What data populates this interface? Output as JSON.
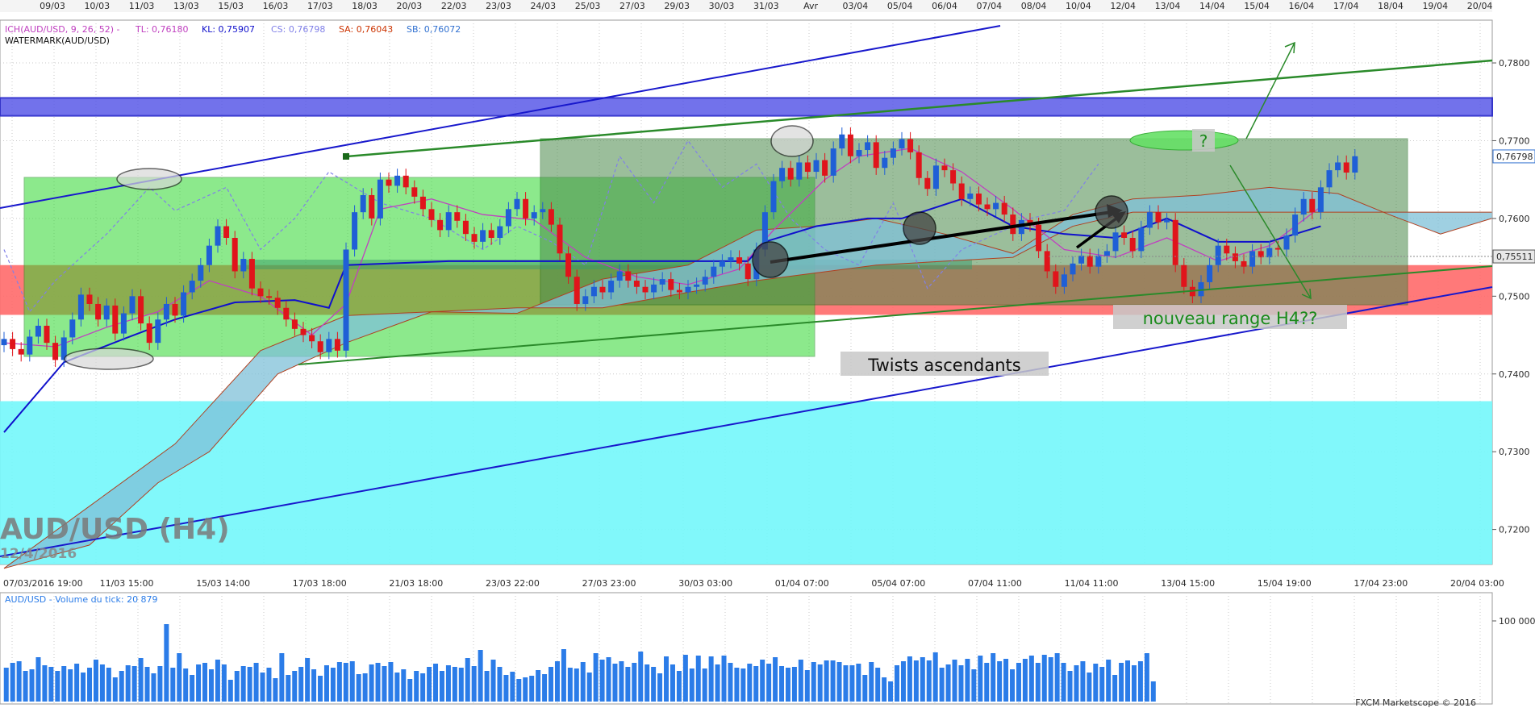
{
  "indicator_header": {
    "ich": "ICH(AUD/USD, 9, 26, 52)  -",
    "tl": "TL: 0,76180",
    "kl": "KL: 0,75907",
    "cs": "CS: 0,76798",
    "sa": "SA: 0,76043",
    "sb": "SB: 0,76072",
    "watermark": "WATERMARK(AUD/USD)"
  },
  "watermark": {
    "title": "AUD/USD (H4)",
    "date": "12/4/2016"
  },
  "volume_header": "AUD/USD - Volume du tick: 20 879",
  "footer": "FXCM Marketscope © 2016",
  "annotations": {
    "question": "?",
    "range": "nouveau range H4??",
    "twists": "Twists ascendants"
  },
  "colors": {
    "bull": "#1f5fd6",
    "bear": "#e0141b",
    "volume": "#2b7ce8",
    "kijun": "#1010cc",
    "tenkan": "#c040c0",
    "chikou": "#8080e8",
    "cloud_bull": "#7fc0d8",
    "cloud_bear": "#c8a090",
    "resistance_zone": "#5a5ae8",
    "support_zone": "#ff6a6a",
    "lower_zone": "#73f7fb",
    "green_box": "#30d830",
    "dark_box": "#4a8a4a"
  },
  "chart_data": [
    {
      "type": "candlestick",
      "symbol": "AUD/USD",
      "timeframe": "H4",
      "top_axis_dates": [
        "09/03",
        "10/03",
        "11/03",
        "13/03",
        "15/03",
        "16/03",
        "17/03",
        "18/03",
        "20/03",
        "22/03",
        "23/03",
        "24/03",
        "25/03",
        "27/03",
        "29/03",
        "30/03",
        "31/03",
        "Avr",
        "03/04",
        "05/04",
        "06/04",
        "07/04",
        "08/04",
        "10/04",
        "12/04",
        "13/04",
        "14/04",
        "15/04",
        "16/04",
        "17/04",
        "18/04",
        "19/04",
        "20/04"
      ],
      "bottom_axis_labels": [
        "07/03/2016 19:00",
        "11/03 15:00",
        "15/03 14:00",
        "17/03 18:00",
        "21/03 18:00",
        "23/03 22:00",
        "27/03 23:00",
        "30/03 03:00",
        "01/04 07:00",
        "05/04 07:00",
        "07/04 11:00",
        "11/04 11:00",
        "13/04 15:00",
        "15/04 19:00",
        "17/04 23:00",
        "20/04 03:00"
      ],
      "y_ticks": [
        "0,7800",
        "0,7700",
        "0,7600",
        "0,7500",
        "0,7400",
        "0,7300",
        "0,7200"
      ],
      "ylim": [
        0.7155,
        0.7855
      ],
      "current_price_label": "0,76798",
      "reference_price_label": "0,75511",
      "close_series": [
        0.7445,
        0.7432,
        0.7425,
        0.7448,
        0.7462,
        0.744,
        0.7418,
        0.7447,
        0.747,
        0.7502,
        0.749,
        0.747,
        0.7488,
        0.7452,
        0.7478,
        0.75,
        0.7465,
        0.744,
        0.747,
        0.749,
        0.7475,
        0.7505,
        0.752,
        0.754,
        0.7565,
        0.759,
        0.7575,
        0.7532,
        0.7548,
        0.751,
        0.75,
        0.7498,
        0.7485,
        0.747,
        0.7458,
        0.745,
        0.7442,
        0.7428,
        0.7445,
        0.743,
        0.756,
        0.7608,
        0.763,
        0.76,
        0.765,
        0.7642,
        0.7655,
        0.764,
        0.7628,
        0.7612,
        0.7598,
        0.7585,
        0.7608,
        0.7597,
        0.758,
        0.757,
        0.7585,
        0.7575,
        0.759,
        0.7612,
        0.7625,
        0.76,
        0.7608,
        0.7612,
        0.7592,
        0.7555,
        0.7525,
        0.749,
        0.75,
        0.7512,
        0.7505,
        0.752,
        0.7532,
        0.752,
        0.7512,
        0.7505,
        0.7515,
        0.7522,
        0.7508,
        0.7505,
        0.7512,
        0.7515,
        0.7525,
        0.7538,
        0.7545,
        0.755,
        0.7542,
        0.7522,
        0.756,
        0.7608,
        0.7648,
        0.7665,
        0.765,
        0.7672,
        0.766,
        0.7675,
        0.7655,
        0.769,
        0.7708,
        0.768,
        0.7688,
        0.7698,
        0.7665,
        0.7678,
        0.769,
        0.7702,
        0.7685,
        0.7652,
        0.7638,
        0.7668,
        0.7662,
        0.7645,
        0.7625,
        0.7632,
        0.7618,
        0.7612,
        0.762,
        0.7605,
        0.758,
        0.7598,
        0.7592,
        0.7558,
        0.7532,
        0.7512,
        0.7528,
        0.7542,
        0.7552,
        0.7538,
        0.7552,
        0.7558,
        0.7582,
        0.7575,
        0.7558,
        0.7588,
        0.7608,
        0.7595,
        0.7598,
        0.754,
        0.7512,
        0.75,
        0.7518,
        0.754,
        0.7565,
        0.7555,
        0.7545,
        0.7538,
        0.7558,
        0.755,
        0.7562,
        0.756,
        0.7578,
        0.7605,
        0.7625,
        0.7608,
        0.764,
        0.7662,
        0.7672,
        0.7659,
        0.768
      ],
      "kijun": [
        [
          0,
          0.7325
        ],
        [
          7,
          0.7415
        ],
        [
          14,
          0.7445
        ],
        [
          20,
          0.747
        ],
        [
          27,
          0.7492
        ],
        [
          34,
          0.7495
        ],
        [
          38,
          0.7485
        ],
        [
          40,
          0.754
        ],
        [
          52,
          0.7545
        ],
        [
          64,
          0.7545
        ],
        [
          80,
          0.7545
        ],
        [
          87,
          0.7545
        ],
        [
          89,
          0.757
        ],
        [
          95,
          0.759
        ],
        [
          101,
          0.76
        ],
        [
          105,
          0.76
        ],
        [
          112,
          0.7625
        ],
        [
          118,
          0.759
        ],
        [
          124,
          0.758
        ],
        [
          130,
          0.7575
        ],
        [
          136,
          0.76
        ],
        [
          142,
          0.757
        ],
        [
          148,
          0.757
        ],
        [
          154,
          0.759
        ]
      ],
      "tenkan": [
        [
          0,
          0.744
        ],
        [
          6,
          0.7435
        ],
        [
          12,
          0.746
        ],
        [
          18,
          0.748
        ],
        [
          24,
          0.752
        ],
        [
          30,
          0.75
        ],
        [
          36,
          0.745
        ],
        [
          40,
          0.749
        ],
        [
          44,
          0.7612
        ],
        [
          50,
          0.7625
        ],
        [
          56,
          0.7605
        ],
        [
          62,
          0.7598
        ],
        [
          68,
          0.755
        ],
        [
          74,
          0.7525
        ],
        [
          80,
          0.7515
        ],
        [
          86,
          0.7535
        ],
        [
          90,
          0.7585
        ],
        [
          96,
          0.765
        ],
        [
          100,
          0.768
        ],
        [
          106,
          0.769
        ],
        [
          112,
          0.766
        ],
        [
          118,
          0.7612
        ],
        [
          124,
          0.756
        ],
        [
          130,
          0.755
        ],
        [
          136,
          0.7575
        ],
        [
          142,
          0.7545
        ],
        [
          148,
          0.7565
        ],
        [
          154,
          0.7615
        ]
      ],
      "chikou": [
        [
          0,
          0.756
        ],
        [
          3,
          0.748
        ],
        [
          6,
          0.752
        ],
        [
          12,
          0.758
        ],
        [
          17,
          0.764
        ],
        [
          20,
          0.761
        ],
        [
          26,
          0.764
        ],
        [
          30,
          0.756
        ],
        [
          34,
          0.76
        ],
        [
          38,
          0.766
        ],
        [
          44,
          0.762
        ],
        [
          50,
          0.76
        ],
        [
          56,
          0.756
        ],
        [
          60,
          0.759
        ],
        [
          64,
          0.757
        ],
        [
          68,
          0.754
        ],
        [
          72,
          0.768
        ],
        [
          76,
          0.762
        ],
        [
          80,
          0.77
        ],
        [
          84,
          0.764
        ],
        [
          88,
          0.767
        ],
        [
          92,
          0.76
        ],
        [
          96,
          0.756
        ],
        [
          100,
          0.754
        ],
        [
          104,
          0.762
        ],
        [
          108,
          0.751
        ],
        [
          112,
          0.756
        ],
        [
          116,
          0.758
        ],
        [
          120,
          0.76
        ],
        [
          124,
          0.761
        ],
        [
          128,
          0.767
        ]
      ],
      "senkou_a": [
        [
          0,
          0.715
        ],
        [
          10,
          0.723
        ],
        [
          20,
          0.731
        ],
        [
          30,
          0.743
        ],
        [
          40,
          0.7475
        ],
        [
          50,
          0.748
        ],
        [
          60,
          0.7478
        ],
        [
          70,
          0.7522
        ],
        [
          80,
          0.754
        ],
        [
          88,
          0.7585
        ],
        [
          95,
          0.759
        ],
        [
          102,
          0.76
        ],
        [
          110,
          0.758
        ],
        [
          118,
          0.7555
        ],
        [
          125,
          0.7605
        ],
        [
          132,
          0.7625
        ],
        [
          140,
          0.763
        ],
        [
          148,
          0.764
        ],
        [
          156,
          0.7632
        ],
        [
          162,
          0.7605
        ],
        [
          168,
          0.758
        ],
        [
          174,
          0.76
        ]
      ],
      "senkou_b": [
        [
          0,
          0.715
        ],
        [
          10,
          0.718
        ],
        [
          18,
          0.726
        ],
        [
          24,
          0.73
        ],
        [
          32,
          0.74
        ],
        [
          40,
          0.744
        ],
        [
          50,
          0.748
        ],
        [
          60,
          0.7485
        ],
        [
          70,
          0.7485
        ],
        [
          80,
          0.7505
        ],
        [
          88,
          0.752
        ],
        [
          95,
          0.753
        ],
        [
          102,
          0.754
        ],
        [
          110,
          0.7545
        ],
        [
          118,
          0.755
        ],
        [
          125,
          0.759
        ],
        [
          132,
          0.7608
        ],
        [
          140,
          0.7608
        ],
        [
          148,
          0.7608
        ],
        [
          156,
          0.7608
        ],
        [
          162,
          0.7608
        ],
        [
          168,
          0.7608
        ],
        [
          174,
          0.7608
        ]
      ],
      "volume": [
        42,
        48,
        50,
        38,
        40,
        55,
        45,
        43,
        38,
        44,
        40,
        47,
        36,
        42,
        52,
        46,
        42,
        30,
        38,
        45,
        44,
        54,
        43,
        35,
        44,
        96,
        42,
        60,
        41,
        33,
        46,
        48,
        40,
        52,
        46,
        27,
        38,
        44,
        43,
        48,
        36,
        42,
        29,
        60,
        33,
        38,
        43,
        54,
        40,
        32,
        45,
        42,
        49,
        48,
        50,
        34,
        35,
        46,
        48,
        44,
        49,
        36,
        40,
        28,
        38,
        35,
        43,
        47,
        38,
        45,
        43,
        42,
        54,
        44,
        64,
        38,
        52,
        43,
        33,
        37,
        28,
        30,
        32,
        39,
        34,
        43,
        50,
        65,
        42,
        41,
        49,
        36,
        60,
        52,
        55,
        47,
        50,
        43,
        48,
        62,
        46,
        43,
        35,
        56,
        46,
        38,
        58,
        41,
        57,
        41,
        56,
        46,
        57,
        48,
        42,
        41,
        47,
        44,
        52,
        47,
        55,
        44,
        42,
        43,
        52,
        39,
        49,
        46,
        51,
        51,
        49,
        45,
        45,
        47,
        33,
        49,
        42,
        30,
        25,
        45,
        50,
        56,
        51,
        55,
        51,
        61,
        42,
        46,
        52,
        45,
        53,
        40,
        57,
        48,
        60,
        50,
        53,
        40,
        48,
        53,
        57,
        48,
        58,
        55,
        60,
        48,
        38,
        45,
        50,
        36,
        47,
        43,
        52,
        33,
        48,
        51,
        45,
        50,
        60,
        25
      ],
      "volume_ylim": [
        0,
        125
      ],
      "volume_tick": "100 000",
      "zones": [
        {
          "kind": "horizontal-band",
          "from": 0.7732,
          "to": 0.7755,
          "color": "resistance_zone"
        },
        {
          "kind": "horizontal-band",
          "from": 0.7476,
          "to": 0.754,
          "color": "support_zone"
        },
        {
          "kind": "horizontal-band",
          "from": 0.7155,
          "to": 0.7365,
          "color": "lower_zone"
        }
      ]
    }
  ]
}
